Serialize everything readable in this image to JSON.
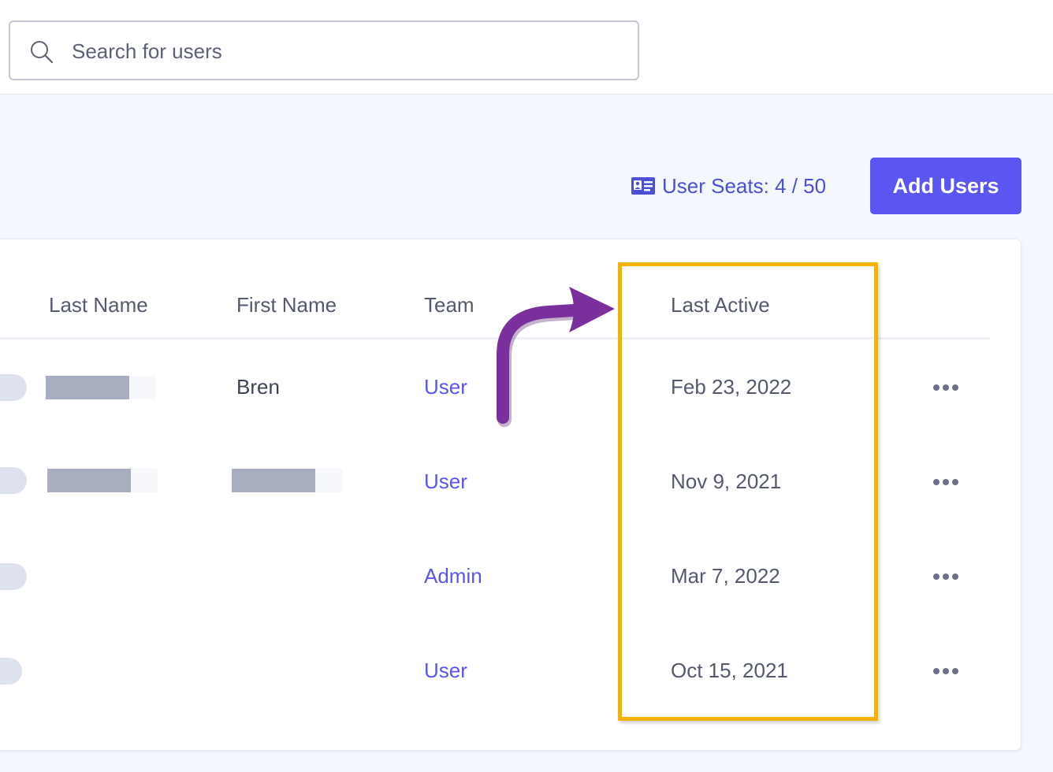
{
  "search": {
    "placeholder": "Search for users",
    "icon": "search-icon"
  },
  "seats": {
    "icon": "id-card-icon",
    "label": "User Seats: 4 / 50"
  },
  "actions": {
    "add_users_label": "Add Users"
  },
  "table": {
    "headers": {
      "last_name": "Last Name",
      "first_name": "First Name",
      "team": "Team",
      "last_active": "Last Active"
    },
    "rows": [
      {
        "last_name": "",
        "first_name": "Bren",
        "team": "User",
        "last_active": "Feb 23, 2022"
      },
      {
        "last_name": "",
        "first_name": "",
        "team": "User",
        "last_active": "Nov 9, 2021"
      },
      {
        "last_name": "",
        "first_name": "",
        "team": "Admin",
        "last_active": "Mar 7, 2022"
      },
      {
        "last_name": "",
        "first_name": "",
        "team": "User",
        "last_active": "Oct 15, 2021"
      }
    ],
    "row_menu_icon": "more-dots-icon"
  },
  "annotation": {
    "highlight_color": "#f5b300",
    "arrow_color": "#7b2f9c",
    "arrow_icon": "curved-arrow-icon"
  },
  "colors": {
    "accent": "#5b55f2",
    "link": "#5a55ee",
    "text": "#3d4456",
    "muted_text": "#535a6d"
  }
}
